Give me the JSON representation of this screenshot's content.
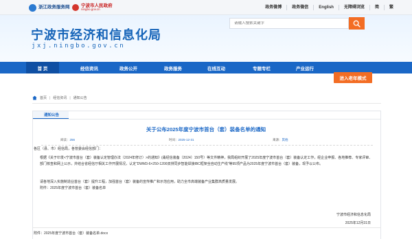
{
  "topbar": {
    "logo1_text": "浙江政务服务网",
    "logo2_title": "宁波市人民政府",
    "logo2_url": "ningbo.gov.cn",
    "links": [
      "政务微博",
      "政务微信",
      "English",
      "无障碍浏览",
      "简",
      "繁"
    ]
  },
  "header": {
    "title": "宁波市经济和信息化局",
    "subtitle": "jxj.ningbo.gov.cn",
    "search_placeholder": "请输入搜索关键字"
  },
  "nav": {
    "items": [
      "首 页",
      "经信资讯",
      "政务公开",
      "政务服务",
      "在线互动",
      "专题专栏",
      "产业运行"
    ],
    "old_mode": "进入老年模式"
  },
  "breadcrumb": {
    "items": [
      "首页",
      "经信资讯",
      "通知公告"
    ]
  },
  "section": {
    "tab": "通知公告"
  },
  "article": {
    "title": "关于公布2025年度宁波市首台（套）装备名单的通知",
    "views_label": "阅读：",
    "views": "256",
    "date_label": "时间：",
    "date": "2025-12-31",
    "source_label": "来源：",
    "source": "其他",
    "salutation": "各区（县、市）经信局，各管委会经信部门：",
    "p1": "根据《关于印发<宁波市首台（套）装备认定管理办法（2024年修订）>的通知》(甬经信装备〔2024〕150号）等文件精神，我局组织开展了2025年度宁波市首台（套）装备认定工作，经企业申报、各地推荐、专家评审、部门核查和网上公示，并结合省经信厅相关工作开展情况，认定“DWM3-6×250-1200双排同步智能焊接IBC框架全自动生产线”等95项产品为2025年度宁波市首台（套）装备，现予以公布。",
    "p2": "请各地深入实施制造业首台（套）提升工程，加强首台（套）装备的宣传推广和示范应用，助力全市高端装备产业集群高质量发展。",
    "p3": "附件：2025年度宁波市首台（套）装备名单",
    "sign_org": "宁波市经济和信息化局",
    "sign_date": "2025年12月31日",
    "attachment": "附件：2025年度宁波市首台（套）装备名单.docx"
  },
  "colors": {
    "brand_blue": "#1a67c6",
    "nav_active": "#0f4fa3",
    "accent_orange": "#f36d24"
  }
}
